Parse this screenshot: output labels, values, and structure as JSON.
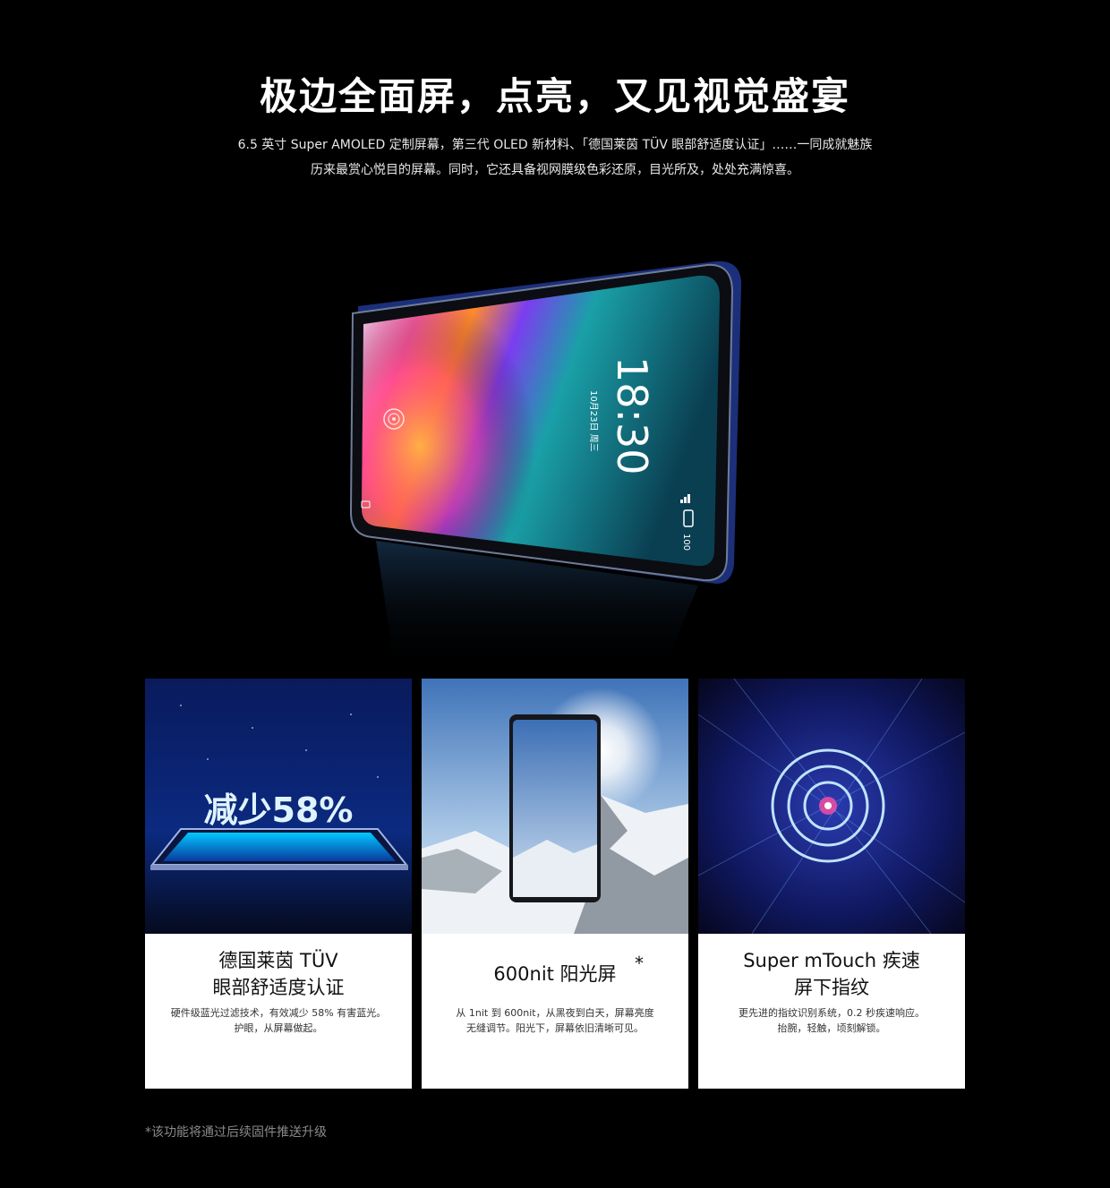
{
  "headline": "极边全面屏，点亮，又见视觉盛宴",
  "intro": {
    "line1": "6.5 英寸 Super AMOLED 定制屏幕，第三代 OLED 新材料、「德国莱茵 TÜV 眼部舒适度认证」……一同成就魅族",
    "line2": "历来最赏心悦目的屏幕。同时，它还具备视网膜级色彩还原，目光所及，处处充满惊喜。"
  },
  "hero_phone": {
    "time": "18:30",
    "date": "10月23日 周三",
    "battery": "100",
    "icons": [
      "fingerprint-icon",
      "camera-icon",
      "signal-icon",
      "battery-icon"
    ]
  },
  "cards": [
    {
      "image_text": "减少58%",
      "title_line1": "德国莱茵 TÜV",
      "title_line2": "眼部舒适度认证",
      "desc_line1": "硬件级蓝光过滤技术，有效减少 58% 有害蓝光。",
      "desc_line2": "护眼，从屏幕做起。"
    },
    {
      "title_line1": "600nit 阳光屏",
      "asterisk": "*",
      "desc_line1": "从 1nit 到 600nit，从黑夜到白天，屏幕亮度",
      "desc_line2": "无缝调节。阳光下，屏幕依旧清晰可见。"
    },
    {
      "title_line1": "Super mTouch 疾速",
      "title_line2": "屏下指纹",
      "desc_line1": "更先进的指纹识别系统，0.2 秒疾速响应。",
      "desc_line2": "抬腕，轻触，顷刻解锁。"
    }
  ],
  "footnote": "*该功能将通过后续固件推送升级",
  "colors": {
    "background": "#000000",
    "card_bg": "#ffffff",
    "accent_blue": "#1e6bff"
  }
}
